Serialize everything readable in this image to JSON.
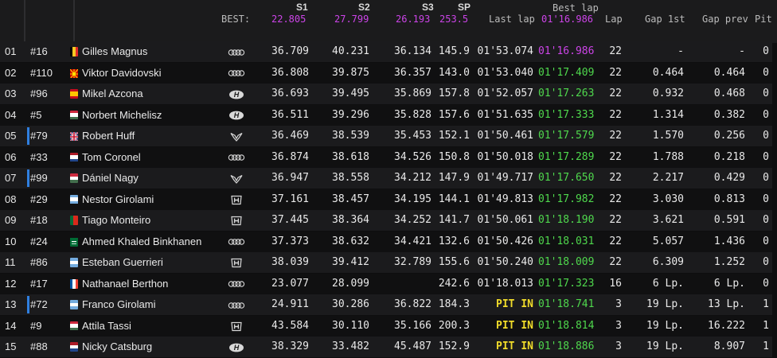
{
  "header": {
    "best_label": "BEST:",
    "s1_label": "S1",
    "s1_best": "22.805",
    "s2_label": "S2",
    "s2_best": "27.799",
    "s3_label": "S3",
    "s3_best": "26.193",
    "sp_label": "SP",
    "sp_best": "253.5",
    "last_lap_label": "Last lap",
    "best_lap_label": "Best lap",
    "best_lap_best": "01'16.986",
    "lap_label": "Lap",
    "gap1_label": "Gap 1st",
    "gapprev_label": "Gap prev",
    "pit_label": "Pit"
  },
  "colors": {
    "purple": "#cc44e8",
    "green": "#4fd84d",
    "yellow": "#f1dc2a",
    "marker": "#2f7fe0"
  },
  "rows": [
    {
      "pos": "01",
      "num": "#16",
      "flag": "flag-belgium",
      "name": "Gilles Magnus",
      "logo": "audi-logo",
      "s1": "36.709",
      "s2": "40.231",
      "s3": "36.134",
      "sp": "145.9",
      "last": "01'53.074",
      "last_color": "white",
      "best": "01'16.986",
      "best_color": "purple",
      "lap": "22",
      "gap1": "-",
      "gapp": "-",
      "pit": "0",
      "marker": false
    },
    {
      "pos": "02",
      "num": "#110",
      "flag": "flag-north-macedonia",
      "name": "Viktor Davidovski",
      "logo": "audi-logo",
      "s1": "36.808",
      "s2": "39.875",
      "s3": "36.357",
      "sp": "143.0",
      "last": "01'53.040",
      "last_color": "white",
      "best": "01'17.409",
      "best_color": "green",
      "lap": "22",
      "gap1": "0.464",
      "gapp": "0.464",
      "pit": "0",
      "marker": false
    },
    {
      "pos": "03",
      "num": "#96",
      "flag": "flag-spain",
      "name": "Mikel Azcona",
      "logo": "hyundai-logo",
      "s1": "36.693",
      "s2": "39.495",
      "s3": "35.869",
      "sp": "157.8",
      "last": "01'52.057",
      "last_color": "white",
      "best": "01'17.263",
      "best_color": "green",
      "lap": "22",
      "gap1": "0.932",
      "gapp": "0.468",
      "pit": "0",
      "marker": false
    },
    {
      "pos": "04",
      "num": "#5",
      "flag": "flag-hungary",
      "name": "Norbert Michelisz",
      "logo": "hyundai-logo",
      "s1": "36.511",
      "s2": "39.296",
      "s3": "35.828",
      "sp": "157.6",
      "last": "01'51.635",
      "last_color": "white",
      "best": "01'17.333",
      "best_color": "green",
      "lap": "22",
      "gap1": "1.314",
      "gapp": "0.382",
      "pit": "0",
      "marker": false
    },
    {
      "pos": "05",
      "num": "#79",
      "flag": "flag-uk",
      "name": "Robert Huff",
      "logo": "cupra-logo",
      "s1": "36.469",
      "s2": "38.539",
      "s3": "35.453",
      "sp": "152.1",
      "last": "01'50.461",
      "last_color": "white",
      "best": "01'17.579",
      "best_color": "green",
      "lap": "22",
      "gap1": "1.570",
      "gapp": "0.256",
      "pit": "0",
      "marker": true
    },
    {
      "pos": "06",
      "num": "#33",
      "flag": "flag-netherlands",
      "name": "Tom Coronel",
      "logo": "audi-logo",
      "s1": "36.874",
      "s2": "38.618",
      "s3": "34.526",
      "sp": "150.8",
      "last": "01'50.018",
      "last_color": "white",
      "best": "01'17.289",
      "best_color": "green",
      "lap": "22",
      "gap1": "1.788",
      "gapp": "0.218",
      "pit": "0",
      "marker": false
    },
    {
      "pos": "07",
      "num": "#99",
      "flag": "flag-hungary",
      "name": "Dániel Nagy",
      "logo": "cupra-logo",
      "s1": "36.947",
      "s2": "38.558",
      "s3": "34.212",
      "sp": "147.9",
      "last": "01'49.717",
      "last_color": "white",
      "best": "01'17.650",
      "best_color": "green",
      "lap": "22",
      "gap1": "2.217",
      "gapp": "0.429",
      "pit": "0",
      "marker": true
    },
    {
      "pos": "08",
      "num": "#29",
      "flag": "flag-argentina",
      "name": "Nestor Girolami",
      "logo": "honda-logo",
      "s1": "37.161",
      "s2": "38.457",
      "s3": "34.195",
      "sp": "144.1",
      "last": "01'49.813",
      "last_color": "white",
      "best": "01'17.982",
      "best_color": "green",
      "lap": "22",
      "gap1": "3.030",
      "gapp": "0.813",
      "pit": "0",
      "marker": false
    },
    {
      "pos": "09",
      "num": "#18",
      "flag": "flag-portugal",
      "name": "Tiago Monteiro",
      "logo": "honda-logo",
      "s1": "37.445",
      "s2": "38.364",
      "s3": "34.252",
      "sp": "141.7",
      "last": "01'50.061",
      "last_color": "white",
      "best": "01'18.190",
      "best_color": "green",
      "lap": "22",
      "gap1": "3.621",
      "gapp": "0.591",
      "pit": "0",
      "marker": false
    },
    {
      "pos": "10",
      "num": "#24",
      "flag": "flag-saudi-arabia",
      "name": "Ahmed Khaled Binkhanen",
      "logo": "audi-logo",
      "s1": "37.373",
      "s2": "38.632",
      "s3": "34.421",
      "sp": "132.6",
      "last": "01'50.426",
      "last_color": "white",
      "best": "01'18.031",
      "best_color": "green",
      "lap": "22",
      "gap1": "5.057",
      "gapp": "1.436",
      "pit": "0",
      "marker": false
    },
    {
      "pos": "11",
      "num": "#86",
      "flag": "flag-argentina",
      "name": "Esteban Guerrieri",
      "logo": "honda-logo",
      "s1": "38.039",
      "s2": "39.412",
      "s3": "32.789",
      "sp": "155.6",
      "last": "01'50.240",
      "last_color": "white",
      "best": "01'18.009",
      "best_color": "green",
      "lap": "22",
      "gap1": "6.309",
      "gapp": "1.252",
      "pit": "0",
      "marker": false
    },
    {
      "pos": "12",
      "num": "#17",
      "flag": "flag-france",
      "name": "Nathanael Berthon",
      "logo": "audi-logo",
      "s1": "23.077",
      "s2": "28.099",
      "s3": "",
      "sp": "242.6",
      "last": "01'18.013",
      "last_color": "white",
      "best": "01'17.323",
      "best_color": "green",
      "lap": "16",
      "gap1": "6 Lp.",
      "gapp": "6 Lp.",
      "pit": "0",
      "marker": false
    },
    {
      "pos": "13",
      "num": "#72",
      "flag": "flag-argentina",
      "name": "Franco Girolami",
      "logo": "audi-logo",
      "s1": "24.911",
      "s2": "30.286",
      "s3": "36.822",
      "sp": "184.3",
      "last": "PIT IN",
      "last_color": "yellow",
      "best": "01'18.741",
      "best_color": "green",
      "lap": "3",
      "gap1": "19 Lp.",
      "gapp": "13 Lp.",
      "pit": "1",
      "marker": true
    },
    {
      "pos": "14",
      "num": "#9",
      "flag": "flag-hungary",
      "name": "Attila Tassi",
      "logo": "honda-logo",
      "s1": "43.584",
      "s2": "30.110",
      "s3": "35.166",
      "sp": "200.3",
      "last": "PIT IN",
      "last_color": "yellow",
      "best": "01'18.814",
      "best_color": "green",
      "lap": "3",
      "gap1": "19 Lp.",
      "gapp": "16.222",
      "pit": "1",
      "marker": false
    },
    {
      "pos": "15",
      "num": "#88",
      "flag": "flag-netherlands",
      "name": "Nicky Catsburg",
      "logo": "hyundai-logo",
      "s1": "38.329",
      "s2": "33.482",
      "s3": "45.487",
      "sp": "152.9",
      "last": "PIT IN",
      "last_color": "yellow",
      "best": "01'18.886",
      "best_color": "green",
      "lap": "3",
      "gap1": "19 Lp.",
      "gapp": "8.907",
      "pit": "1",
      "marker": false
    }
  ]
}
